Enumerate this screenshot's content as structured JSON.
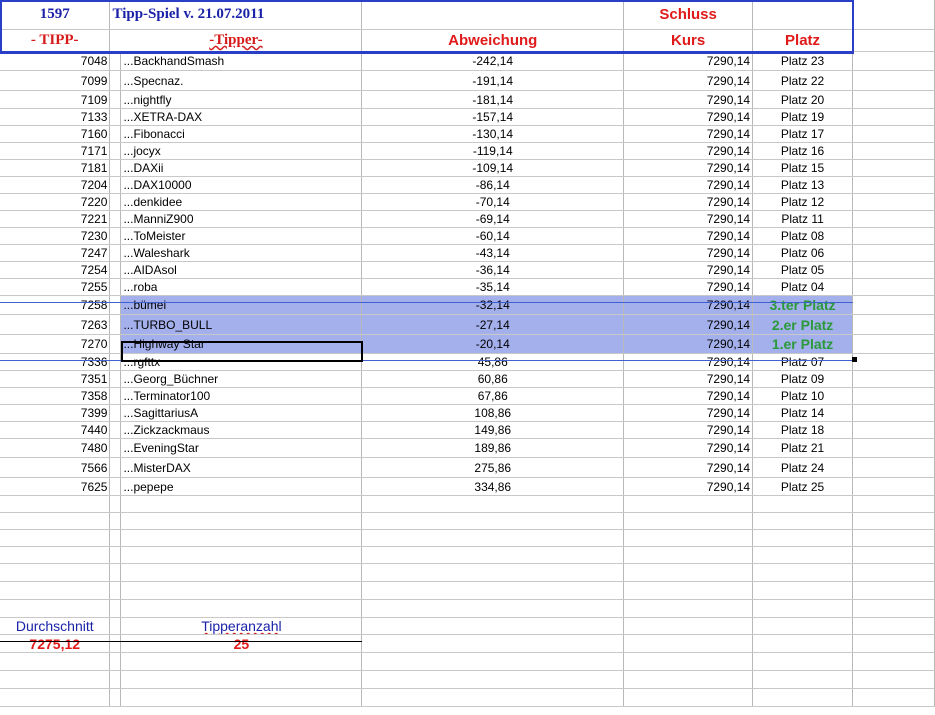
{
  "header": {
    "id": "1597",
    "title": "Tipp-Spiel v. 21.07.2011",
    "schluss": "Schluss",
    "col_tipp": "- TIPP-",
    "col_tipper": "-Tipper-",
    "col_abweichung": "Abweichung",
    "col_kurs": "Kurs",
    "col_platz": "Platz"
  },
  "rows": [
    {
      "tipp": "7048",
      "tipper": "...BackhandSmash",
      "abw": "-242,14",
      "kurs": "7290,14",
      "platz": "Platz 23"
    },
    {
      "tipp": "7099",
      "tipper": "...Specnaz.",
      "abw": "-191,14",
      "kurs": "7290,14",
      "platz": "Platz 22"
    },
    {
      "tipp": "7109",
      "tipper": "...nightfly",
      "abw": "-181,14",
      "kurs": "7290,14",
      "platz": "Platz 20"
    },
    {
      "tipp": "7133",
      "tipper": "...XETRA-DAX",
      "abw": "-157,14",
      "kurs": "7290,14",
      "platz": "Platz 19"
    },
    {
      "tipp": "7160",
      "tipper": "...Fibonacci",
      "abw": "-130,14",
      "kurs": "7290,14",
      "platz": "Platz 17"
    },
    {
      "tipp": "7171",
      "tipper": "...jocyx",
      "abw": "-119,14",
      "kurs": "7290,14",
      "platz": "Platz 16"
    },
    {
      "tipp": "7181",
      "tipper": "...DAXii",
      "abw": "-109,14",
      "kurs": "7290,14",
      "platz": "Platz 15"
    },
    {
      "tipp": "7204",
      "tipper": "...DAX10000",
      "abw": "-86,14",
      "kurs": "7290,14",
      "platz": "Platz 13"
    },
    {
      "tipp": "7220",
      "tipper": "...denkidee",
      "abw": "-70,14",
      "kurs": "7290,14",
      "platz": "Platz 12"
    },
    {
      "tipp": "7221",
      "tipper": "...ManniZ900",
      "abw": "-69,14",
      "kurs": "7290,14",
      "platz": "Platz 11"
    },
    {
      "tipp": "7230",
      "tipper": "...ToMeister",
      "abw": "-60,14",
      "kurs": "7290,14",
      "platz": "Platz 08"
    },
    {
      "tipp": "7247",
      "tipper": "...Waleshark",
      "abw": "-43,14",
      "kurs": "7290,14",
      "platz": "Platz 06"
    },
    {
      "tipp": "7254",
      "tipper": "...AIDAsol",
      "abw": "-36,14",
      "kurs": "7290,14",
      "platz": "Platz 05"
    },
    {
      "tipp": "7255",
      "tipper": "...roba",
      "abw": "-35,14",
      "kurs": "7290,14",
      "platz": "Platz 04"
    },
    {
      "tipp": "7258",
      "tipper": "...bümei",
      "abw": "-32,14",
      "kurs": "7290,14",
      "platz": "3.ter Platz"
    },
    {
      "tipp": "7263",
      "tipper": "...TURBO_BULL",
      "abw": "-27,14",
      "kurs": "7290,14",
      "platz": "2.er Platz"
    },
    {
      "tipp": "7270",
      "tipper": "...Highway Star",
      "abw": "-20,14",
      "kurs": "7290,14",
      "platz": "1.er Platz"
    },
    {
      "tipp": "7336",
      "tipper": "...rgfttx",
      "abw": "45,86",
      "kurs": "7290,14",
      "platz": "Platz 07"
    },
    {
      "tipp": "7351",
      "tipper": "...Georg_Büchner",
      "abw": "60,86",
      "kurs": "7290,14",
      "platz": "Platz 09"
    },
    {
      "tipp": "7358",
      "tipper": "...Terminator100",
      "abw": "67,86",
      "kurs": "7290,14",
      "platz": "Platz 10"
    },
    {
      "tipp": "7399",
      "tipper": "...SagittariusA",
      "abw": "108,86",
      "kurs": "7290,14",
      "platz": "Platz 14"
    },
    {
      "tipp": "7440",
      "tipper": "...Zickzackmaus",
      "abw": "149,86",
      "kurs": "7290,14",
      "platz": "Platz 18"
    },
    {
      "tipp": "7480",
      "tipper": "...EveningStar",
      "abw": "189,86",
      "kurs": "7290,14",
      "platz": "Platz 21"
    },
    {
      "tipp": "7566",
      "tipper": "...MisterDAX",
      "abw": "275,86",
      "kurs": "7290,14",
      "platz": "Platz 24"
    },
    {
      "tipp": "7625",
      "tipper": "...pepepe",
      "abw": "334,86",
      "kurs": "7290,14",
      "platz": "Platz 25"
    }
  ],
  "summary": {
    "avg_label": "Durchschnitt",
    "avg_value": "7275,12",
    "count_label": "Tipperanzahl",
    "count_value": "25"
  }
}
